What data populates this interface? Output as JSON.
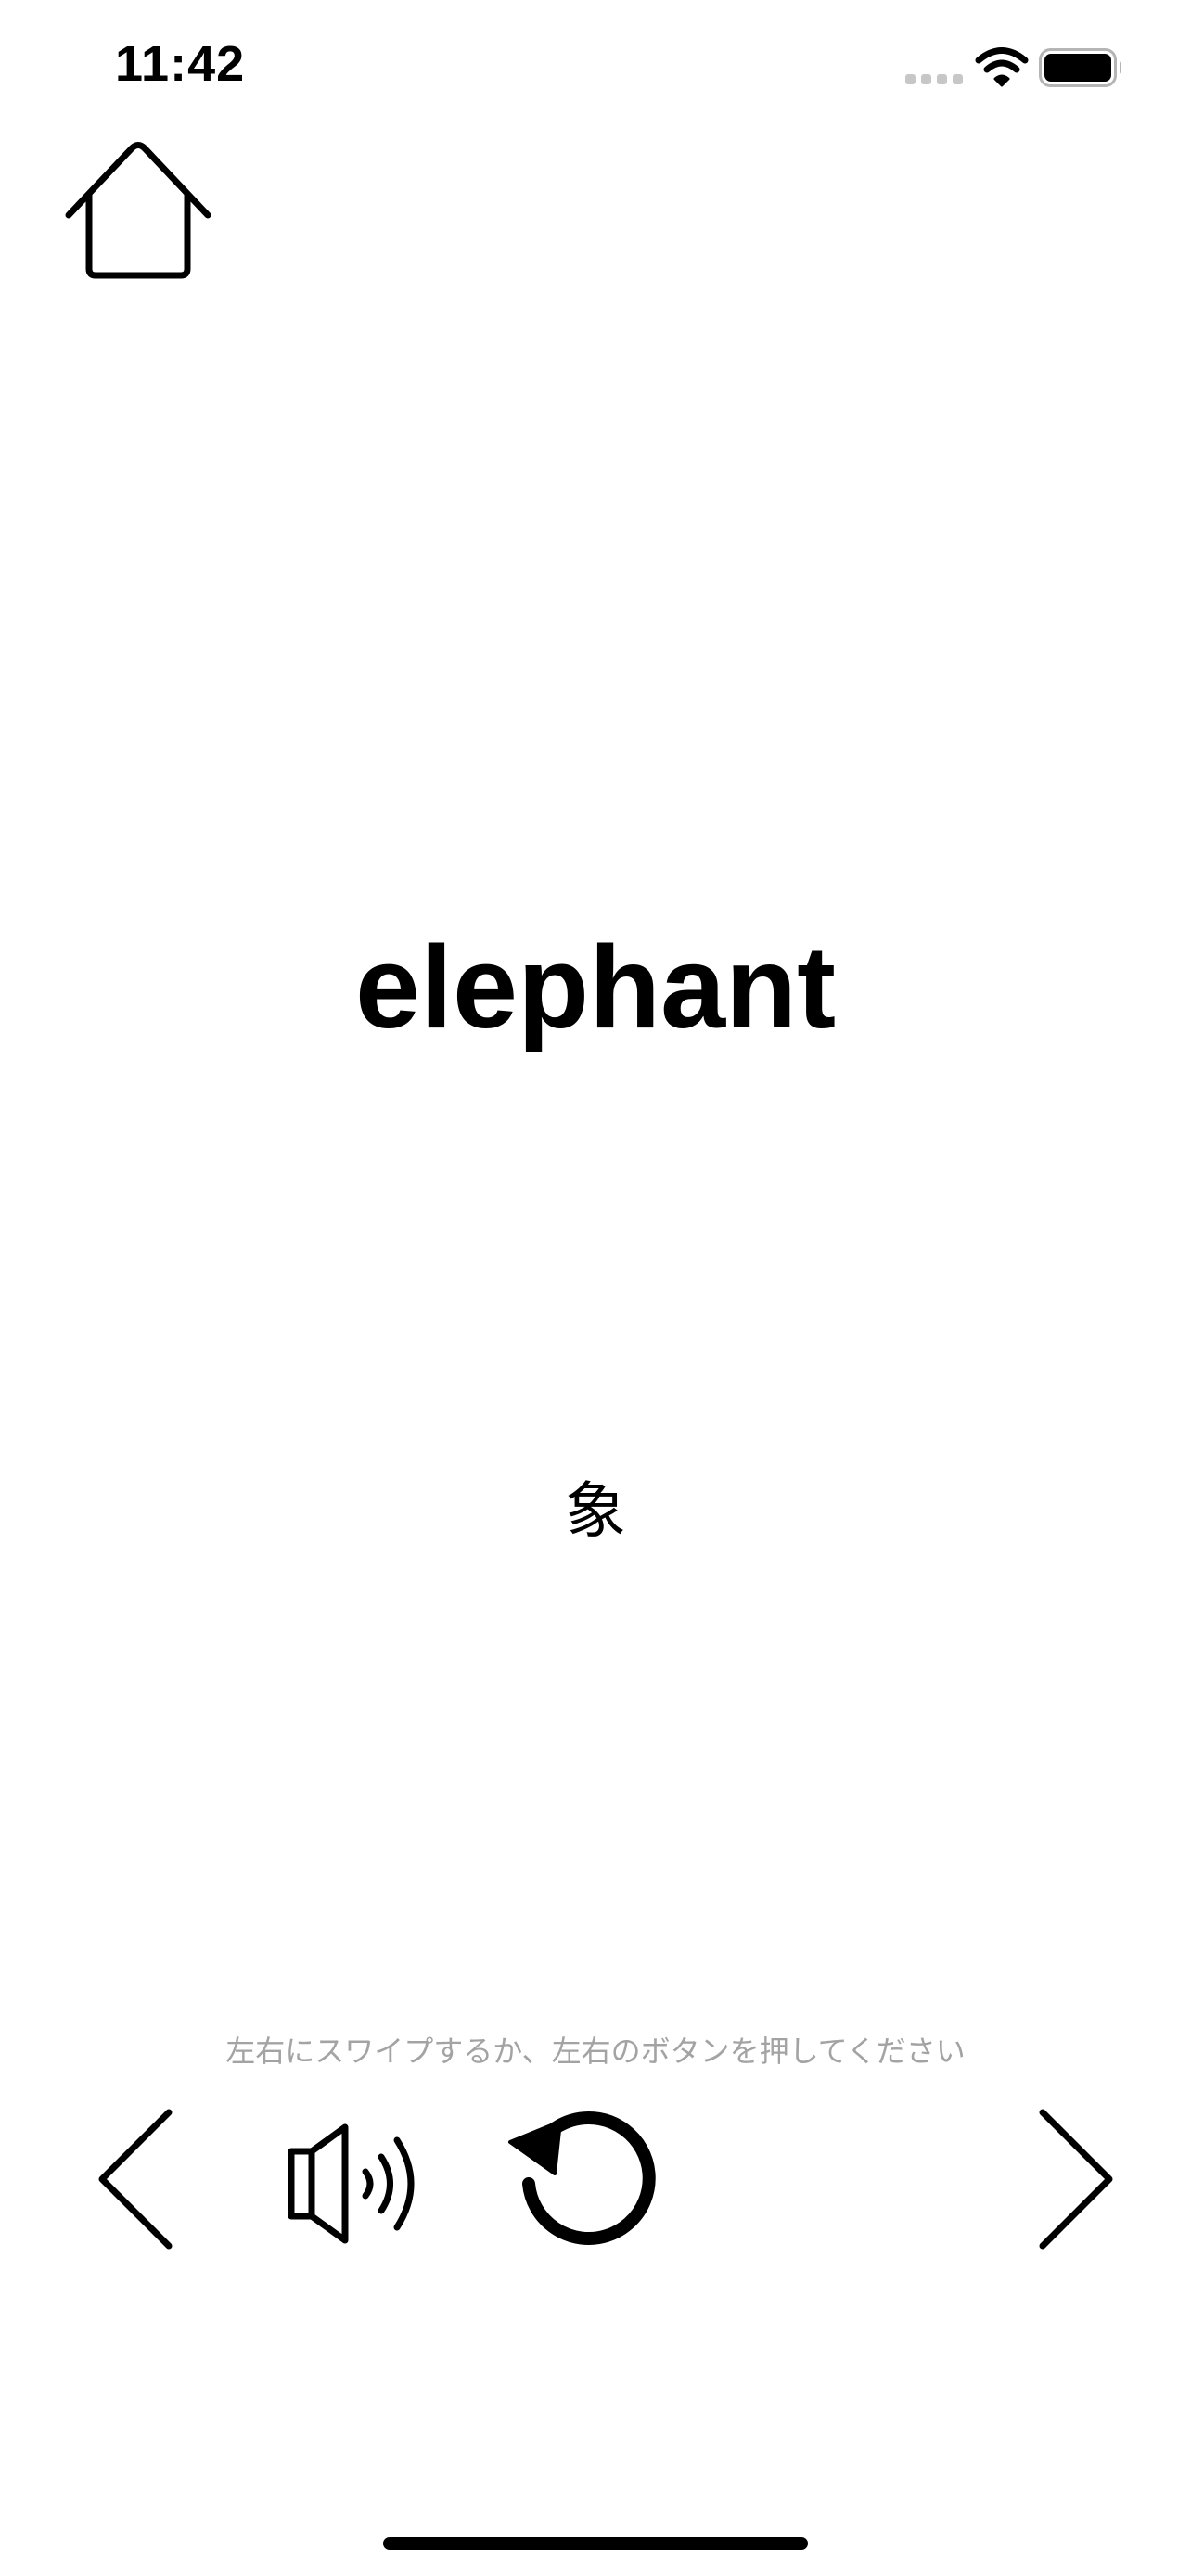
{
  "status_bar": {
    "time": "11:42"
  },
  "icons": {
    "home": "home-icon",
    "prev": "chevron-left-icon",
    "speaker": "speaker-icon",
    "replay": "replay-icon",
    "next": "chevron-right-icon",
    "signal": "signal-icon",
    "wifi": "wifi-icon",
    "battery": "battery-icon"
  },
  "card": {
    "word": "elephant",
    "translation": "象"
  },
  "hint": "左右にスワイプするか、左右のボタンを押してください",
  "colors": {
    "text": "#000000",
    "hint": "#a3a3a3",
    "background": "#ffffff"
  }
}
